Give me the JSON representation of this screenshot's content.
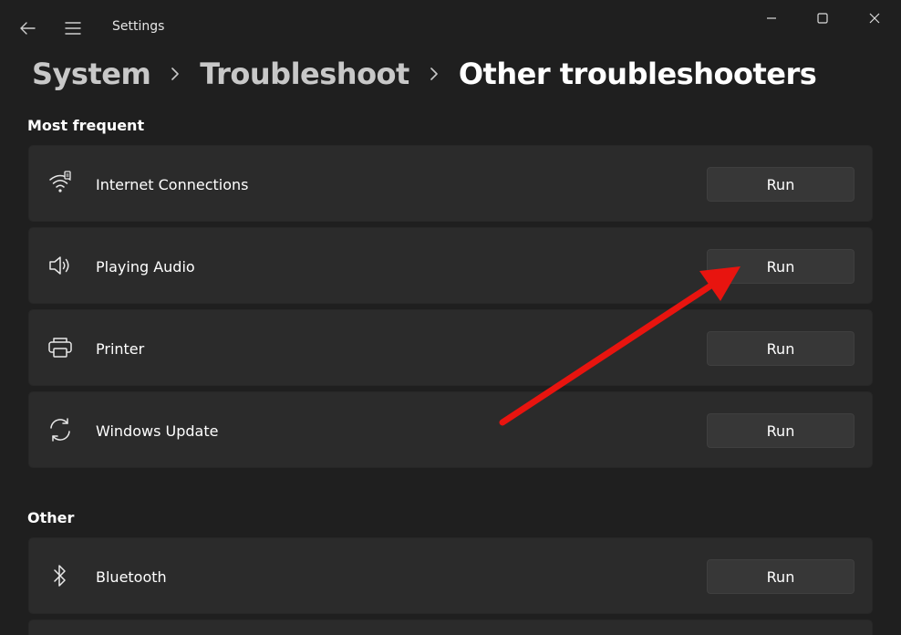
{
  "window": {
    "title": "Settings"
  },
  "icons": {
    "back": "back-arrow-icon",
    "menu": "hamburger-menu-icon",
    "minimize": "minimize-icon",
    "maximize": "maximize-icon",
    "close": "close-icon"
  },
  "breadcrumb": {
    "items": [
      "System",
      "Troubleshoot",
      "Other troubleshooters"
    ]
  },
  "sections": {
    "most_frequent": {
      "title": "Most frequent",
      "items": [
        {
          "label": "Internet Connections",
          "icon": "wifi-icon",
          "button": "Run"
        },
        {
          "label": "Playing Audio",
          "icon": "speaker-icon",
          "button": "Run"
        },
        {
          "label": "Printer",
          "icon": "printer-icon",
          "button": "Run"
        },
        {
          "label": "Windows Update",
          "icon": "sync-icon",
          "button": "Run"
        }
      ]
    },
    "other": {
      "title": "Other",
      "items": [
        {
          "label": "Bluetooth",
          "icon": "bluetooth-icon",
          "button": "Run"
        }
      ]
    }
  },
  "annotation": {
    "arrow_color": "#e8140f"
  },
  "colors": {
    "background": "#1f1f1f",
    "card": "#2b2b2b",
    "button": "#373737"
  }
}
